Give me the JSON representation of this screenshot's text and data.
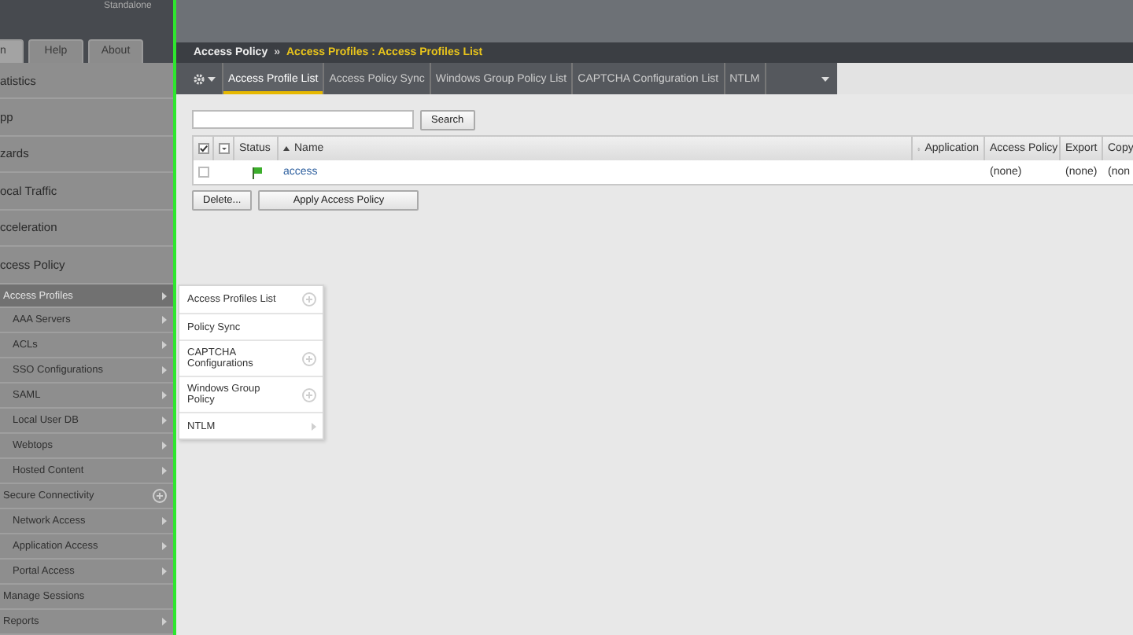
{
  "sidebar": {
    "status": "Standalone",
    "tabs": [
      {
        "label": "n",
        "selected": true
      },
      {
        "label": "Help",
        "selected": false
      },
      {
        "label": "About",
        "selected": false
      }
    ],
    "items": [
      {
        "label": "atistics",
        "selected": false
      },
      {
        "label": "pp",
        "selected": false
      },
      {
        "label": "zards",
        "selected": false
      },
      {
        "label": "ocal Traffic",
        "selected": false
      },
      {
        "label": "cceleration",
        "selected": false
      },
      {
        "label": "ccess Policy",
        "selected": false,
        "children": [
          {
            "label": "Access Profiles",
            "kind": "link",
            "selected": true,
            "children": [
              {
                "label": "AAA Servers",
                "kind": "link",
                "selected": false
              },
              {
                "label": "ACLs",
                "kind": "link",
                "selected": false
              },
              {
                "label": "SSO Configurations",
                "kind": "link",
                "selected": false
              },
              {
                "label": "SAML",
                "kind": "link",
                "selected": false
              },
              {
                "label": "Local User DB",
                "kind": "link",
                "selected": false
              },
              {
                "label": "Webtops",
                "kind": "link",
                "selected": false
              },
              {
                "label": "Hosted Content",
                "kind": "link",
                "selected": false
              }
            ]
          },
          {
            "label": "Secure Connectivity",
            "kind": "create",
            "selected": false,
            "children": [
              {
                "label": "Network Access",
                "kind": "link",
                "selected": false
              },
              {
                "label": "Application Access",
                "kind": "link",
                "selected": false
              },
              {
                "label": "Portal Access",
                "kind": "link",
                "selected": false
              }
            ]
          },
          {
            "label": "Manage Sessions",
            "selected": false
          },
          {
            "label": "Reports",
            "kind": "link",
            "selected": false
          }
        ]
      }
    ]
  },
  "flyout": [
    {
      "label": "Access Profiles List",
      "kind": "create"
    },
    {
      "label": "Policy Sync"
    },
    {
      "label": "CAPTCHA Configurations",
      "kind": "create"
    },
    {
      "label": "Windows Group Policy",
      "kind": "create"
    },
    {
      "label": "NTLM",
      "kind": "link"
    }
  ],
  "breadcrumb": {
    "section": "Access Policy",
    "separator": "»",
    "page": "Access Profiles : Access Profiles List"
  },
  "tabs": [
    {
      "label": "Access Profile List",
      "selected": true
    },
    {
      "label": "Access Policy Sync",
      "selected": false
    },
    {
      "label": "Windows Group Policy List",
      "selected": false
    },
    {
      "label": "CAPTCHA Configuration List",
      "selected": false
    },
    {
      "label": "NTLM",
      "selected": false
    }
  ],
  "search": {
    "button": "Search"
  },
  "table": {
    "all_checked": true,
    "columns": [
      "Status",
      "Name",
      "Application",
      "Access Policy",
      "Export",
      "Copy"
    ],
    "rows": [
      {
        "checked": false,
        "name": "access",
        "application": "",
        "access_policy": "(none)",
        "export": "(none)",
        "copy": "(non"
      }
    ]
  },
  "buttons": [
    "Delete...",
    "Apply Access Policy"
  ]
}
